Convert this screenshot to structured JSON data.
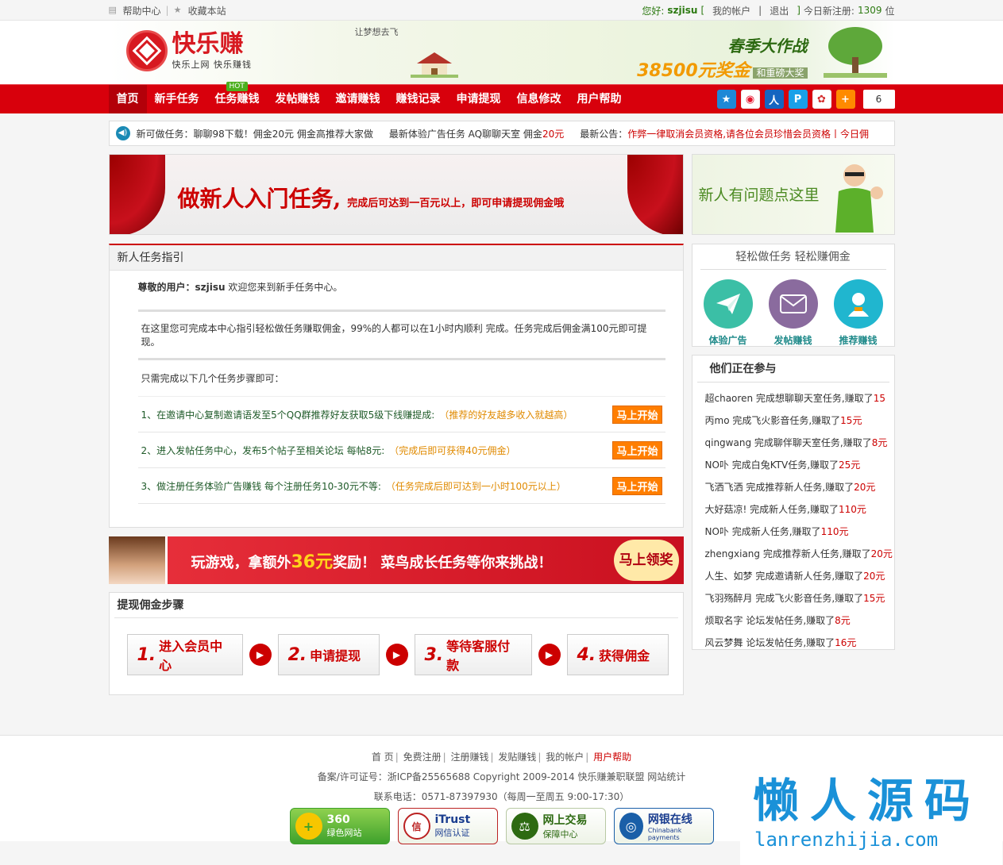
{
  "topbar": {
    "help_center": "帮助中心",
    "bookmark": "收藏本站",
    "greeting": "您好:",
    "username": "szjisu",
    "bracket_open": "[",
    "my_account": "我的帐户",
    "pipe": "|",
    "logout": "退出",
    "bracket_close": "]",
    "today_reg_label": "今日新注册:",
    "today_reg_count": "1309",
    "today_reg_unit": "位"
  },
  "header": {
    "logo_title": "快乐赚",
    "logo_sub": "快乐上网 快乐赚钱",
    "slogan": "让梦想去飞",
    "promo_line1": "春季大作战",
    "promo_line2": "38500元奖金",
    "promo_line3": "和重磅大奖"
  },
  "nav": {
    "items": [
      {
        "label": "首页"
      },
      {
        "label": "新手任务"
      },
      {
        "label": "任务赚钱"
      },
      {
        "label": "发帖赚钱"
      },
      {
        "label": "邀请赚钱"
      },
      {
        "label": "赚钱记录"
      },
      {
        "label": "申请提现"
      },
      {
        "label": "信息修改"
      },
      {
        "label": "用户帮助"
      }
    ],
    "hot_badge": "HOT",
    "share_count": "6"
  },
  "notice": {
    "item1": "新可做任务：聊聊98下载！佣金20元 佣金高推荐大家做",
    "item2_prefix": "最新体验广告任务 AQ聊聊天室 佣金",
    "item2_amount": "20元",
    "item3_prefix": "最新公告：",
    "item3_text": "作弊一律取消会员资格,请各位会员珍惜会员资格丨今日佣"
  },
  "banner_top": {
    "big": "做新人入门任务,",
    "small": "完成后可达到一百元以上，即可申请提现佣金哦"
  },
  "help_banner": {
    "text": "新人有问题点这里"
  },
  "newbie": {
    "title": "新人任务指引",
    "greet_label": "尊敬的用户：",
    "greet_user": "szjisu",
    "greet_text": "欢迎您来到新手任务中心。",
    "desc": "在这里您可完成本中心指引轻松做任务赚取佣金，99%的人都可以在1小时内顺利 完成。任务完成后佣金满100元即可提现。",
    "steps_intro": "只需完成以下几个任务步骤即可：",
    "steps": [
      {
        "text": "1、在邀请中心复制邀请语发至5个QQ群推荐好友获取5级下线赚提成:",
        "note": "（推荐的好友越多收入就越高）",
        "button": "马上开始"
      },
      {
        "text": "2、进入发帖任务中心，发布5个帖子至相关论坛 每帖8元:",
        "note": "（完成后即可获得40元佣金）",
        "button": "马上开始"
      },
      {
        "text": "3、做注册任务体验广告赚钱 每个注册任务10-30元不等:",
        "note": "（任务完成后即可达到一小时100元以上）",
        "button": "马上开始"
      }
    ]
  },
  "banner_game": {
    "pre": "玩游戏，拿额外",
    "amount": "36元",
    "post": "奖励！ 菜鸟成长任务等你来挑战！",
    "button": "马上领奖"
  },
  "withdraw": {
    "title": "提现佣金步骤",
    "steps": [
      {
        "num": "1.",
        "label": "进入会员中心"
      },
      {
        "num": "2.",
        "label": "申请提现"
      },
      {
        "num": "3.",
        "label": "等待客服付款"
      },
      {
        "num": "4.",
        "label": "获得佣金"
      }
    ]
  },
  "easy": {
    "title": "轻松做任务 轻松赚佣金",
    "items": [
      {
        "label": "体验广告",
        "color": "#3bbfa6"
      },
      {
        "label": "发帖赚钱",
        "color": "#8a6b9e"
      },
      {
        "label": "推荐赚钱",
        "color": "#20b6cf"
      }
    ]
  },
  "join": {
    "title": "他们正在参与",
    "items": [
      {
        "text": "超chaoren 完成想聊聊天室任务,赚取了",
        "amount": "15"
      },
      {
        "text": "丙mo 完成飞火影音任务,赚取了",
        "amount": "15元"
      },
      {
        "text": "qingwang 完成聊伴聊天室任务,赚取了",
        "amount": "8元"
      },
      {
        "text": "NO卟  完成白兔KTV任务,赚取了",
        "amount": "25元"
      },
      {
        "text": "飞洒飞洒 完成推荐新人任务,赚取了",
        "amount": "20元"
      },
      {
        "text": "大好菇凉! 完成新人任务,赚取了",
        "amount": "110元"
      },
      {
        "text": "NO卟  完成新人任务,赚取了",
        "amount": "110元"
      },
      {
        "text": "zhengxiang 完成推荐新人任务,赚取了",
        "amount": "20元"
      },
      {
        "text": "人生、如梦 完成邀请新人任务,赚取了",
        "amount": "20元"
      },
      {
        "text": "飞羽殇醉月 完成飞火影音任务,赚取了",
        "amount": "15元"
      },
      {
        "text": "烦取名字 论坛发帖任务,赚取了",
        "amount": "8元"
      },
      {
        "text": "风云梦舞 论坛发帖任务,赚取了",
        "amount": "16元"
      }
    ]
  },
  "footer": {
    "links": [
      "首 页",
      "免费注册",
      "注册赚钱",
      "发贴赚钱",
      "我的帐户",
      "用户帮助"
    ],
    "icp": "备案/许可证号：浙ICP备25565688   Copyright 2009-2014 快乐赚兼职联盟   网站统计",
    "contact": "联系电话：0571-87397930（每周一至周五 9:00-17:30）",
    "badges": [
      {
        "t1": "360",
        "t2": "绿色网站"
      },
      {
        "t1": "iTrust",
        "t2": "网信认证"
      },
      {
        "t1": "网上交易",
        "t2": "保障中心"
      },
      {
        "t1": "网银在线",
        "t2": "Chinabank payments"
      }
    ]
  },
  "watermark": {
    "big": "懒人源码",
    "url": "lanrenzhijia.com"
  }
}
